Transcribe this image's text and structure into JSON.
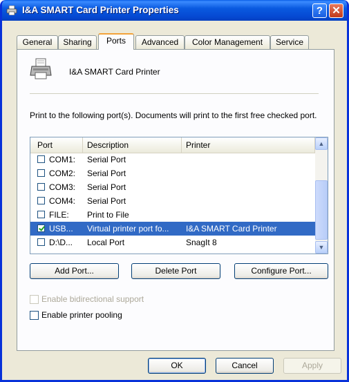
{
  "window": {
    "title": "I&A SMART Card Printer Properties",
    "help_glyph": "?",
    "close_glyph": "✕"
  },
  "tabs": [
    {
      "label": "General"
    },
    {
      "label": "Sharing"
    },
    {
      "label": "Ports"
    },
    {
      "label": "Advanced"
    },
    {
      "label": "Color Management"
    },
    {
      "label": "Service"
    }
  ],
  "active_tab": "Ports",
  "printer_name": "I&A SMART Card Printer",
  "description": "Print to the following port(s). Documents will print to the first free checked port.",
  "port_list": {
    "columns": [
      "Port",
      "Description",
      "Printer"
    ],
    "rows": [
      {
        "checked": false,
        "port": "COM1:",
        "description": "Serial Port",
        "printer": "",
        "selected": false
      },
      {
        "checked": false,
        "port": "COM2:",
        "description": "Serial Port",
        "printer": "",
        "selected": false
      },
      {
        "checked": false,
        "port": "COM3:",
        "description": "Serial Port",
        "printer": "",
        "selected": false
      },
      {
        "checked": false,
        "port": "COM4:",
        "description": "Serial Port",
        "printer": "",
        "selected": false
      },
      {
        "checked": false,
        "port": "FILE:",
        "description": "Print to File",
        "printer": "",
        "selected": false
      },
      {
        "checked": true,
        "port": "USB...",
        "description": "Virtual printer port fo...",
        "printer": "I&A SMART Card Printer",
        "selected": true
      },
      {
        "checked": false,
        "port": "D:\\D...",
        "description": "Local Port",
        "printer": "SnagIt 8",
        "selected": false
      }
    ],
    "scroll_up_glyph": "▲",
    "scroll_down_glyph": "▼"
  },
  "port_buttons": {
    "add": "Add Port...",
    "delete": "Delete Port",
    "configure": "Configure Port..."
  },
  "options": {
    "bidirectional": {
      "label": "Enable bidirectional support",
      "checked": false,
      "enabled": false
    },
    "pooling": {
      "label": "Enable printer pooling",
      "checked": false,
      "enabled": true
    }
  },
  "dialog_buttons": {
    "ok": "OK",
    "cancel": "Cancel",
    "apply": "Apply"
  },
  "colors": {
    "titlebar": "#0a5ae0",
    "selection": "#316ac5",
    "tab_highlight": "#f2a23a"
  }
}
